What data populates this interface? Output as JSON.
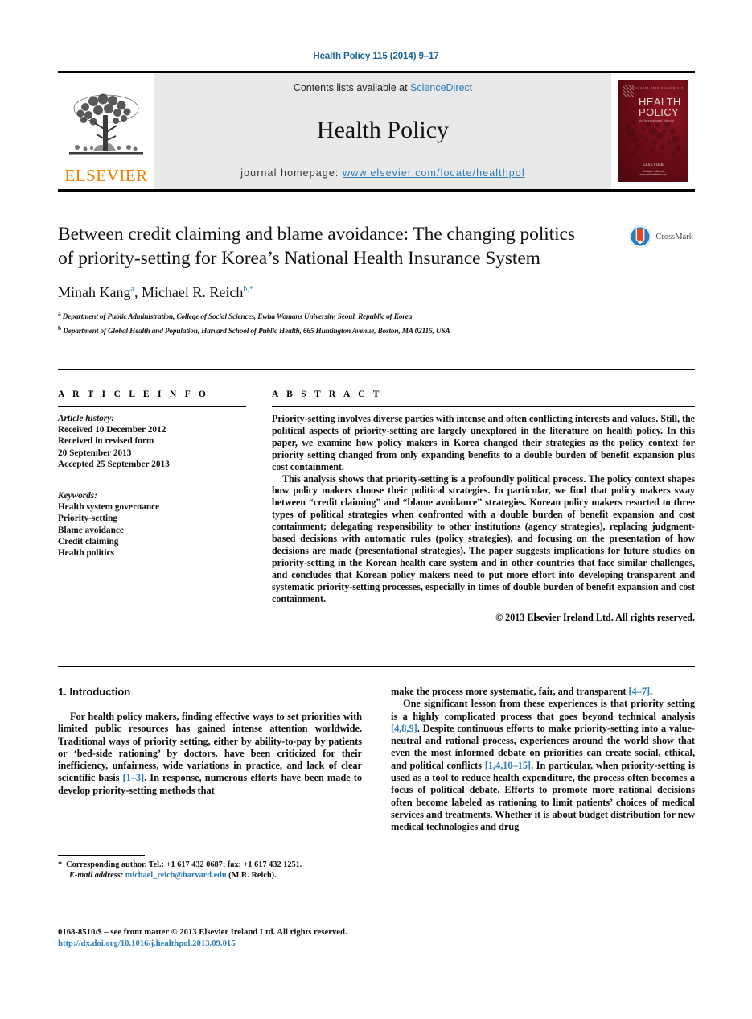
{
  "running_head": "Health Policy 115 (2014) 9–17",
  "masthead": {
    "publisher": "ELSEVIER",
    "contents_prefix": "Contents lists available at ",
    "contents_link": "ScienceDirect",
    "journal_name": "Health Policy",
    "homepage_prefix": "journal homepage: ",
    "homepage_url": "www.elsevier.com/locate/healthpol",
    "cover": {
      "title_line1": "HEALTH",
      "title_line2": "POLICY",
      "subtitle": "An International Journal",
      "topbar": "ISSN 0168-8510  VOLUME 115",
      "publisher": "ELSEVIER",
      "foot_line1": "Available online at",
      "foot_line2": "www.sciencedirect.com"
    }
  },
  "article": {
    "title": "Between credit claiming and blame avoidance: The changing politics of priority-setting for Korea’s National Health Insurance System",
    "crossmark_label": "CrossMark",
    "authors": [
      {
        "name": "Minah Kang",
        "marks": "a"
      },
      {
        "name": "Michael R. Reich",
        "marks": "b,*"
      }
    ],
    "affiliations": [
      {
        "mark": "a",
        "text": "Department of Public Administration, College of Social Sciences, Ewha Womans University, Seoul, Republic of Korea"
      },
      {
        "mark": "b",
        "text": "Department of Global Health and Population, Harvard School of Public Health, 665 Huntington Avenue, Boston, MA 02115, USA"
      }
    ]
  },
  "article_info": {
    "label": "A R T I C L E  I N F O",
    "history_label": "Article history:",
    "history": [
      "Received 10 December 2012",
      "Received in revised form",
      "20 September 2013",
      "Accepted 25 September 2013"
    ],
    "keywords_label": "Keywords:",
    "keywords": [
      "Health system governance",
      "Priority-setting",
      "Blame avoidance",
      "Credit claiming",
      "Health politics"
    ]
  },
  "abstract": {
    "label": "A B S T R A C T",
    "paragraphs": [
      "Priority-setting involves diverse parties with intense and often conflicting interests and values. Still, the political aspects of priority-setting are largely unexplored in the literature on health policy. In this paper, we examine how policy makers in Korea changed their strategies as the policy context for priority setting changed from only expanding benefits to a double burden of benefit expansion plus cost containment.",
      "This analysis shows that priority-setting is a profoundly political process. The policy context shapes how policy makers choose their political strategies. In particular, we find that policy makers sway between “credit claiming” and “blame avoidance” strategies. Korean policy makers resorted to three types of political strategies when confronted with a double burden of benefit expansion and cost containment; delegating responsibility to other institutions (agency strategies), replacing judgment-based decisions with automatic rules (policy strategies), and focusing on the presentation of how decisions are made (presentational strategies). The paper suggests implications for future studies on priority-setting in the Korean health care system and in other countries that face similar challenges, and concludes that Korean policy makers need to put more effort into developing transparent and systematic priority-setting processes, especially in times of double burden of benefit expansion and cost containment."
    ],
    "copyright": "© 2013 Elsevier Ireland Ltd. All rights reserved."
  },
  "body": {
    "section_heading": "1. Introduction",
    "left_paragraph_1_a": "For health policy makers, finding effective ways to set priorities with limited public resources has gained intense attention worldwide. Traditional ways of priority setting, either by ability-to-pay by patients or ‘bed-side rationing’ by doctors, have been criticized for their inefficiency, unfairness, wide variations in practice, and lack of clear scientific basis ",
    "left_ref_1": "[1–3]",
    "left_paragraph_1_b": ". In response, numerous efforts have been made to develop priority-setting methods that",
    "right_paragraph_1_a": "make the process more systematic, fair, and transparent ",
    "right_ref_1": "[4–7]",
    "right_paragraph_1_b": ".",
    "right_paragraph_2_a": "One significant lesson from these experiences is that priority setting is a highly complicated process that goes beyond technical analysis ",
    "right_ref_2": "[4,8,9]",
    "right_paragraph_2_b": ". Despite continuous efforts to make priority-setting into a value-neutral and rational process, experiences around the world show that even the most informed debate on priorities can create social, ethical, and political conflicts ",
    "right_ref_3": "[1,4,10–15]",
    "right_paragraph_2_c": ". In particular, when priority-setting is used as a tool to reduce health expenditure, the process often becomes a focus of political debate. Efforts to promote more rational decisions often become labeled as rationing to limit patients’ choices of medical services and treatments. Whether it is about budget distribution for new medical technologies and drug"
  },
  "footnote": {
    "star": "*",
    "corresponding": "Corresponding author. Tel.: +1 617 432 0687; fax: +1 617 432 1251.",
    "email_label": "E-mail address:",
    "email": "michael_reich@harvard.edu",
    "email_owner": "(M.R. Reich)."
  },
  "colophon": {
    "line1": "0168-8510/$ – see front matter © 2013 Elsevier Ireland Ltd. All rights reserved.",
    "doi": "http://dx.doi.org/10.1016/j.healthpol.2013.09.015"
  },
  "colors": {
    "link": "#2b7bb9",
    "elsevier_orange": "#ef7d00",
    "band_gray": "#e9e9e9",
    "cover_red": "#6b0d15"
  }
}
